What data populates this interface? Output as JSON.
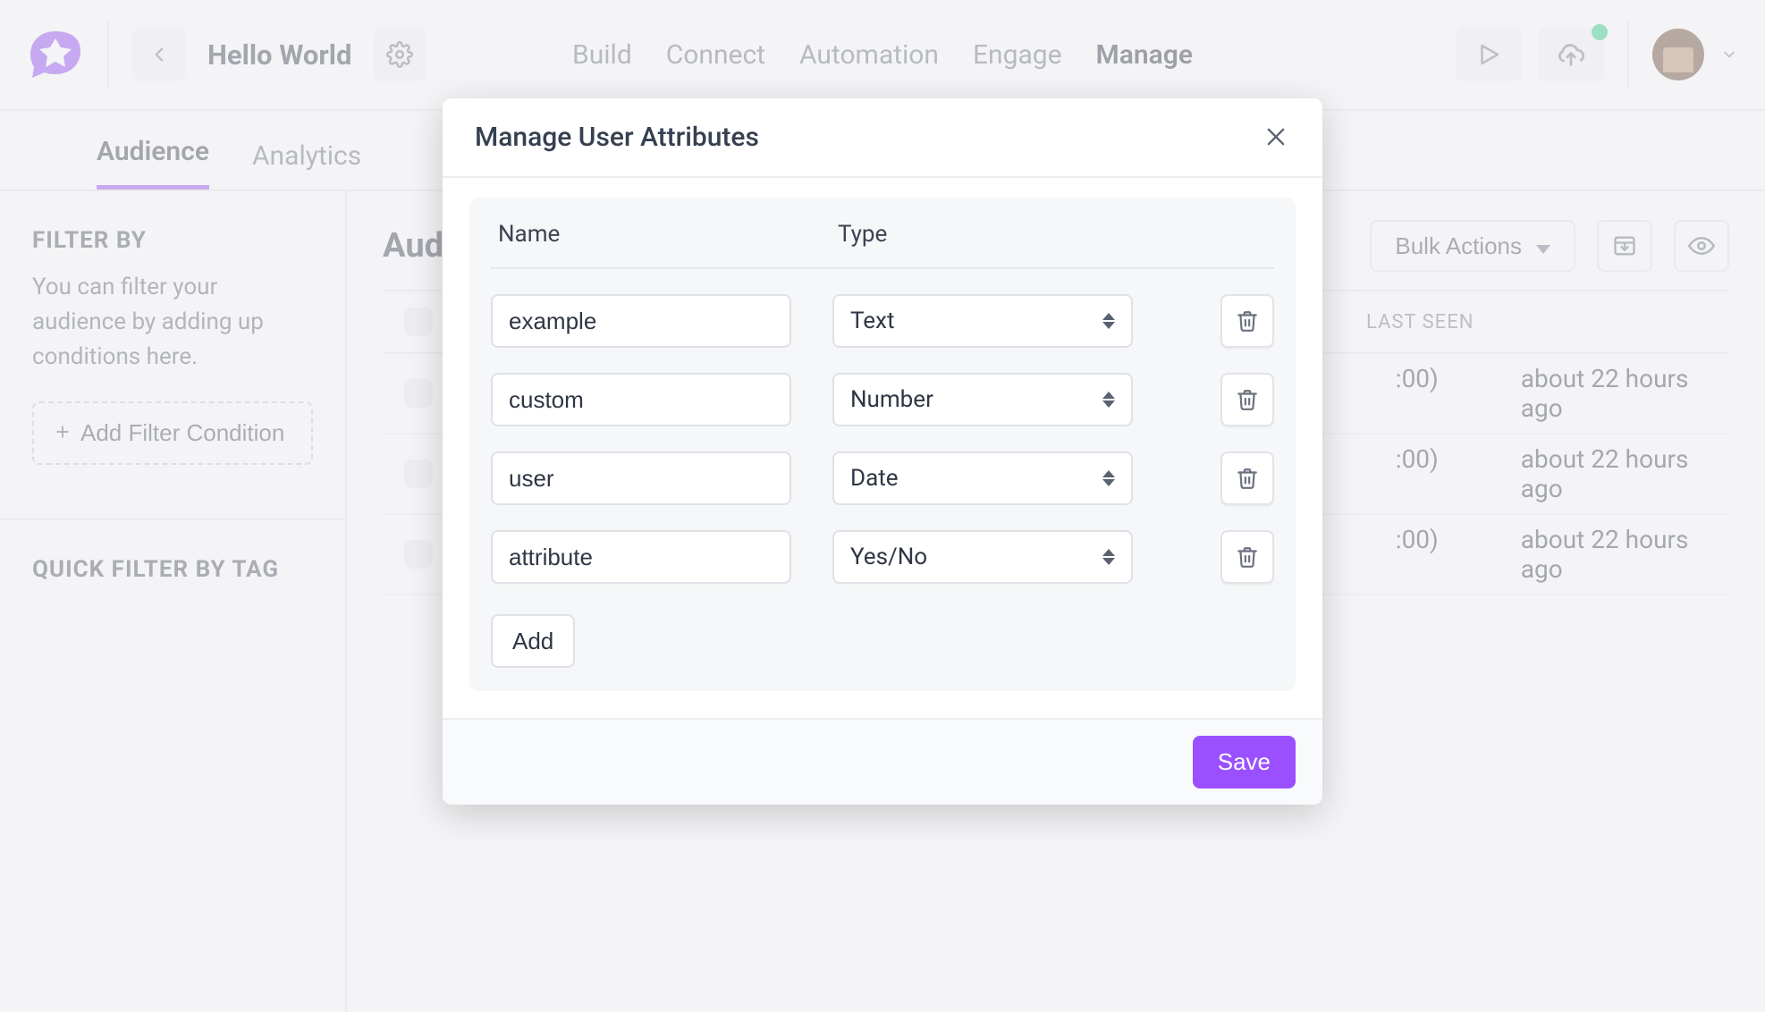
{
  "project_title": "Hello World",
  "nav": {
    "items": [
      "Build",
      "Connect",
      "Automation",
      "Engage",
      "Manage"
    ],
    "active_index": 4
  },
  "subtabs": {
    "items": [
      "Audience",
      "Analytics"
    ],
    "active_index": 0
  },
  "sidebar": {
    "filter_title": "FILTER BY",
    "filter_text": "You can filter your audience by adding up conditions here.",
    "add_filter_label": "Add Filter Condition",
    "quick_filter_title": "QUICK FILTER BY TAG"
  },
  "content": {
    "title_partial": "Aud",
    "bulk_actions_label": "Bulk Actions",
    "columns": {
      "last_seen": "LAST SEEN"
    },
    "rows": [
      {
        "time_partial": ":00)",
        "last_seen": "about 22 hours ago"
      },
      {
        "time_partial": ":00)",
        "last_seen": "about 22 hours ago"
      },
      {
        "time_partial": ":00)",
        "last_seen": "about 22 hours ago"
      }
    ]
  },
  "modal": {
    "title": "Manage User Attributes",
    "col_name": "Name",
    "col_type": "Type",
    "rows": [
      {
        "name": "example",
        "type": "Text"
      },
      {
        "name": "custom",
        "type": "Number"
      },
      {
        "name": "user",
        "type": "Date"
      },
      {
        "name": "attribute",
        "type": "Yes/No"
      }
    ],
    "add_label": "Add",
    "save_label": "Save"
  },
  "colors": {
    "accent": "#9a50ff",
    "status_dot": "#15c77e"
  }
}
